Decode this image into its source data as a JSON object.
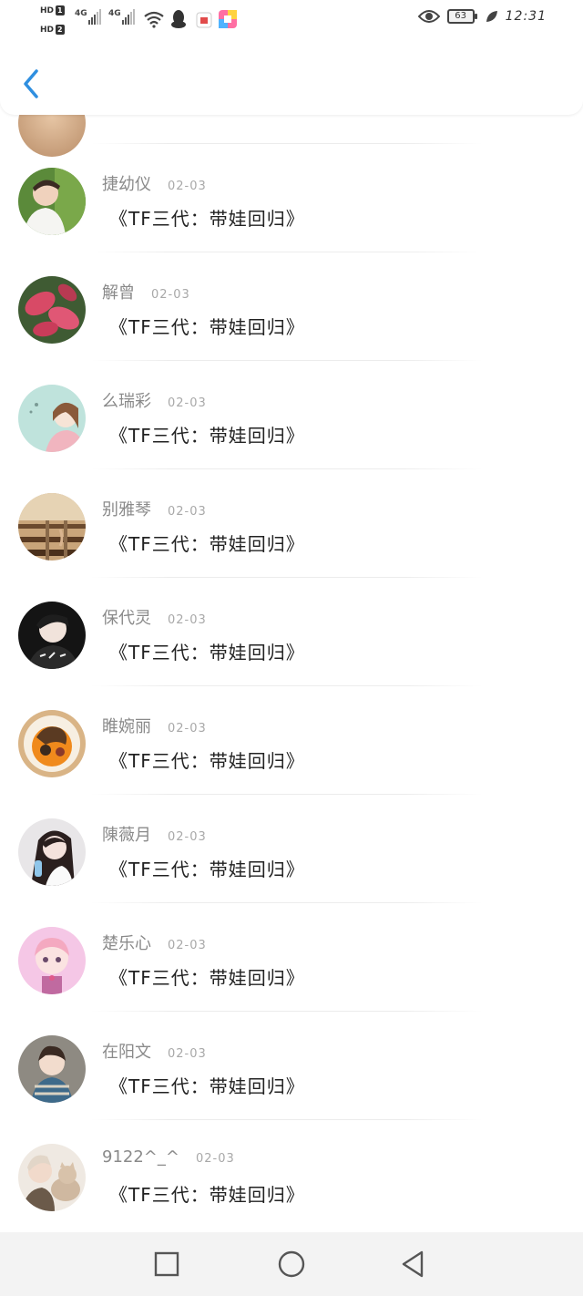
{
  "status_bar": {
    "hd1": "HD",
    "hd1_num": "1",
    "hd2": "HD",
    "hd2_num": "2",
    "signal1_label": "4G",
    "signal2_label": "4G",
    "battery": "63",
    "time": "12:31",
    "icons": [
      "wifi-icon",
      "qq-icon",
      "app-notification-icon",
      "app-colorful-icon",
      "eye-comfort-icon",
      "battery-icon",
      "leaf-icon"
    ]
  },
  "header": {
    "back_icon": "chevron-left-icon",
    "accent": "#2f8fe0"
  },
  "comments": [
    {
      "name": "",
      "date": "",
      "text": "",
      "avatar": "partial"
    },
    {
      "name": "捷幼仪",
      "date": "02-03",
      "text": "《TF三代：带娃回归》",
      "avatar": "young-man-green"
    },
    {
      "name": "解曾",
      "date": "02-03",
      "text": "《TF三代：带娃回归》",
      "avatar": "pink-leaves"
    },
    {
      "name": "么瑞彩",
      "date": "02-03",
      "text": "《TF三代：带娃回归》",
      "avatar": "girl-illustration"
    },
    {
      "name": "别雅琴",
      "date": "02-03",
      "text": "《TF三代：带娃回归》",
      "avatar": "railway-track"
    },
    {
      "name": "保代灵",
      "date": "02-03",
      "text": "《TF三代：带娃回归》",
      "avatar": "boy-dark"
    },
    {
      "name": "睢婉丽",
      "date": "02-03",
      "text": "《TF三代：带娃回归》",
      "avatar": "orange-illustration"
    },
    {
      "name": "陳薇月",
      "date": "02-03",
      "text": "《TF三代：带娃回归》",
      "avatar": "girl-with-bottle"
    },
    {
      "name": "楚乐心",
      "date": "02-03",
      "text": "《TF三代：带娃回归》",
      "avatar": "pink-cartoon-girl"
    },
    {
      "name": "在阳文",
      "date": "02-03",
      "text": "《TF三代：带娃回归》",
      "avatar": "child-scarf"
    },
    {
      "name": "9122^_^",
      "date": "02-03",
      "text": "《TF三代：带娃回归》",
      "avatar": "person-with-cat"
    }
  ],
  "nav": {
    "recent_icon": "square-recent-apps-icon",
    "home_icon": "circle-home-icon",
    "back_icon": "triangle-back-icon"
  }
}
